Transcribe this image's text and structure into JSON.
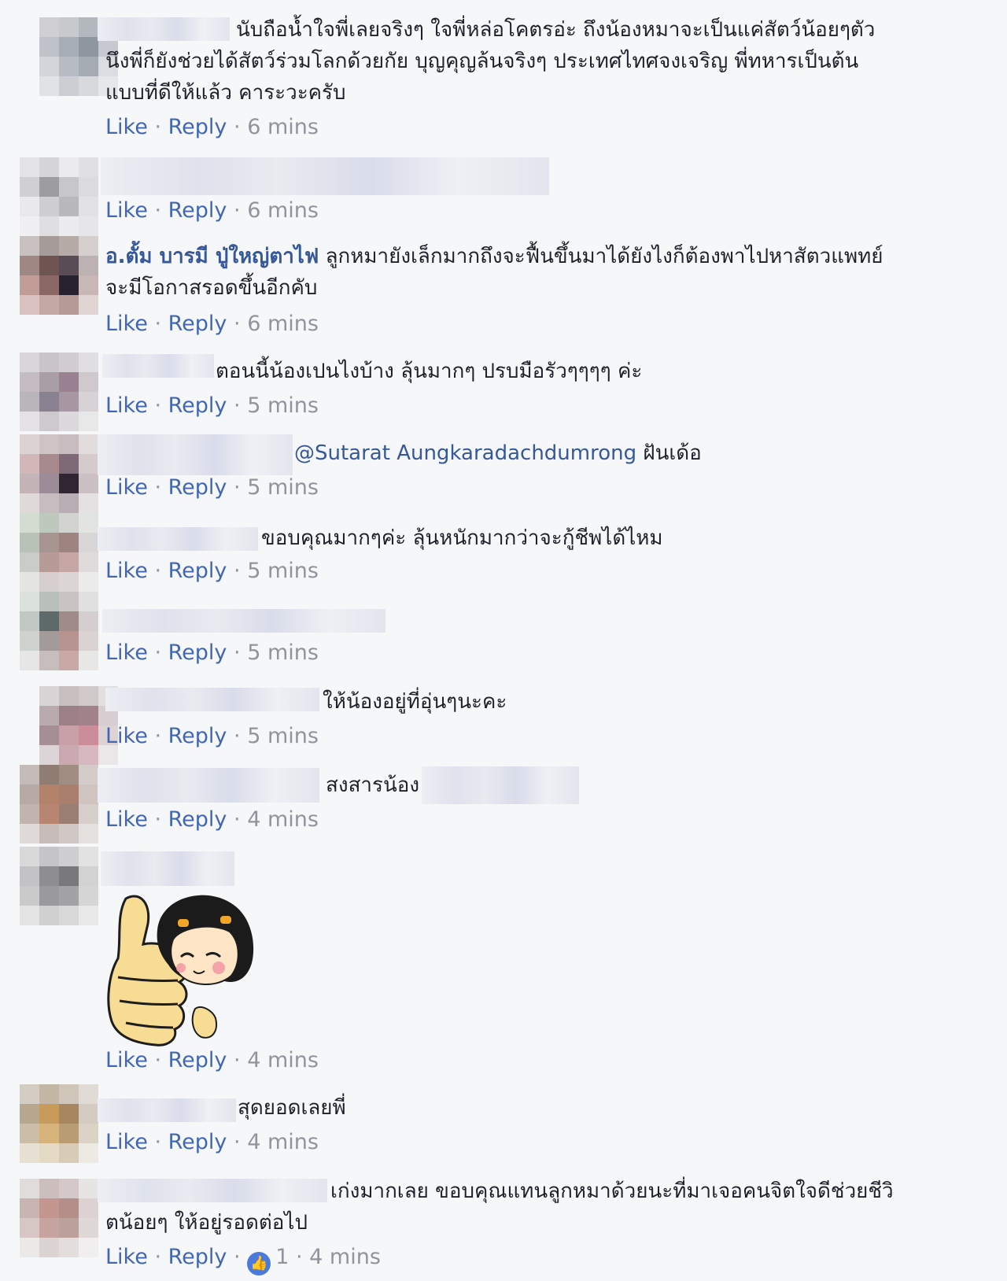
{
  "comments": [
    {
      "lines": [
        "นับถือน้ำใจพี่เลยจริงๆ ใจพี่หล่อโคตรอ่ะ ถึงน้องหมาจะเป็นแค่สัตว์น้อยๆตัว",
        "นึงพี่ก็ยังช่วยได้สัตว์ร่วมโลกด้วยกัย บุญคุญล้นจริงๆ ประเทศไทศจงเจริญ พี่ทหารเป็นต้น",
        "แบบที่ดีให้แล้ว คาระวะครับ"
      ],
      "like": "Like",
      "reply": "Reply",
      "time": "6 mins"
    },
    {
      "lines": [],
      "like": "Like",
      "reply": "Reply",
      "time": "6 mins"
    },
    {
      "author": "อ.ตั้ม บารมี ปู่ใหญ่ตาไฟ",
      "lines": [
        "ลูกหมายังเล็กมากถึงจะฟื้นขึ้นมาได้ยังไงก็ต้องพาไปหาสัตวแพทย์",
        "จะมีโอกาสรอดขึ้นอีกคับ"
      ],
      "like": "Like",
      "reply": "Reply",
      "time": "6 mins"
    },
    {
      "lines": [
        "ตอนนี้น้องเปนไงบ้าง ลุ้นมากๆ ปรบมือรัวๆๆๆๆ ค่ะ"
      ],
      "like": "Like",
      "reply": "Reply",
      "time": "5 mins"
    },
    {
      "mention": "@Sutarat Aungkaradachdumrong",
      "lines": [
        "ฝันเด้อ"
      ],
      "like": "Like",
      "reply": "Reply",
      "time": "5 mins"
    },
    {
      "lines": [
        "ขอบคุณมากๆค่ะ ลุ้นหนักมากว่าจะกู้ชีพได้ไหม"
      ],
      "like": "Like",
      "reply": "Reply",
      "time": "5 mins"
    },
    {
      "lines": [],
      "like": "Like",
      "reply": "Reply",
      "time": "5 mins"
    },
    {
      "lines": [
        "ให้น้องอยู่ที่อุ่นๆนะคะ"
      ],
      "like": "Like",
      "reply": "Reply",
      "time": "5 mins"
    },
    {
      "lines": [
        "สงสารน้อง"
      ],
      "like": "Like",
      "reply": "Reply",
      "time": "4 mins"
    },
    {
      "lines": [],
      "sticker": "thumbs-up-girl-sticker",
      "like": "Like",
      "reply": "Reply",
      "time": "4 mins"
    },
    {
      "lines": [
        "สุดยอดเลยพี่"
      ],
      "like": "Like",
      "reply": "Reply",
      "time": "4 mins"
    },
    {
      "lines": [
        "เก่งมากเลย ขอบคุณแทนลูกหมาด้วยนะที่มาเจอคนจิตใจดีช่วยชีวิ",
        "ตน้อยๆ ให้อยู่รอดต่อไป"
      ],
      "like": "Like",
      "reply": "Reply",
      "reactions": "1",
      "time": "4 mins"
    }
  ],
  "separator": "·"
}
